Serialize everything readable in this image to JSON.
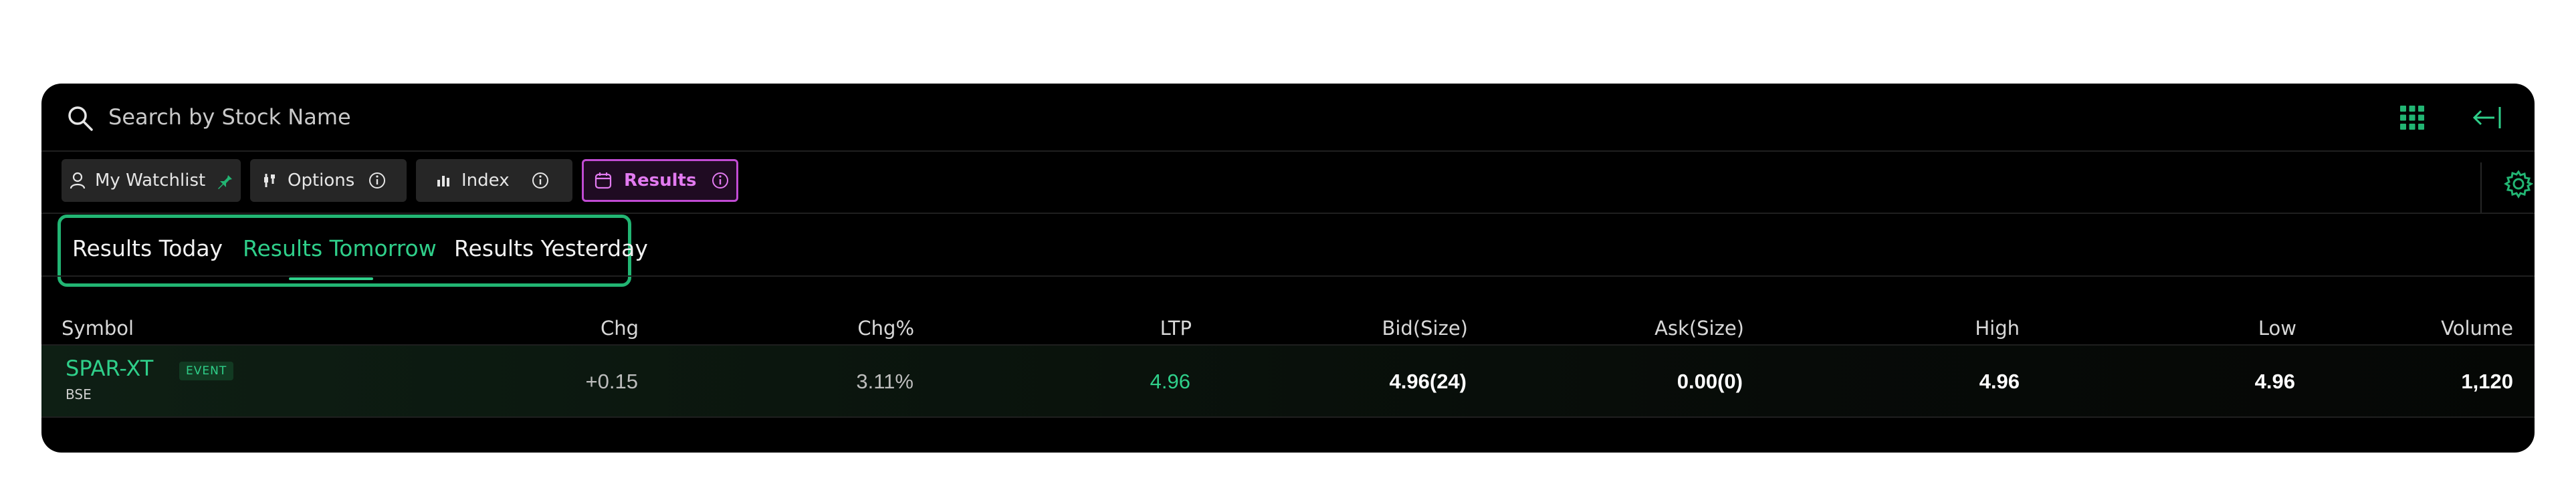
{
  "search": {
    "placeholder": "Search by Stock Name"
  },
  "icons": {
    "search": "search-icon",
    "grid": "grid-icon",
    "collapse": "collapse-left-icon",
    "settings": "gear-icon"
  },
  "chips": [
    {
      "label": "My Watchlist",
      "icon": "user-icon",
      "trailing": "pin-icon"
    },
    {
      "label": "Options",
      "icon": "options-icon",
      "trailing": "info-icon"
    },
    {
      "label": "Index",
      "icon": "index-icon",
      "trailing": "info-icon"
    },
    {
      "label": "Results",
      "icon": "calendar-icon",
      "trailing": "info-icon",
      "active": true
    }
  ],
  "subtabs": [
    {
      "label": "Results Today"
    },
    {
      "label": "Results Tomorrow",
      "active": true
    },
    {
      "label": "Results Yesterday"
    }
  ],
  "table": {
    "columns": [
      "Symbol",
      "Chg",
      "Chg%",
      "LTP",
      "Bid(Size)",
      "Ask(Size)",
      "High",
      "Low",
      "Volume"
    ],
    "rows": [
      {
        "symbol": "SPAR-XT",
        "badge": "EVENT",
        "exchange": "BSE",
        "chg": "+0.15",
        "chg_pct": "3.11%",
        "ltp": "4.96",
        "bid": "4.96(24)",
        "ask": "0.00(0)",
        "high": "4.96",
        "low": "4.96",
        "volume": "1,120"
      }
    ]
  },
  "colors": {
    "accent_green": "#2fcf8a",
    "active_chip": "#c14bd3",
    "panel_bg": "#000000"
  }
}
